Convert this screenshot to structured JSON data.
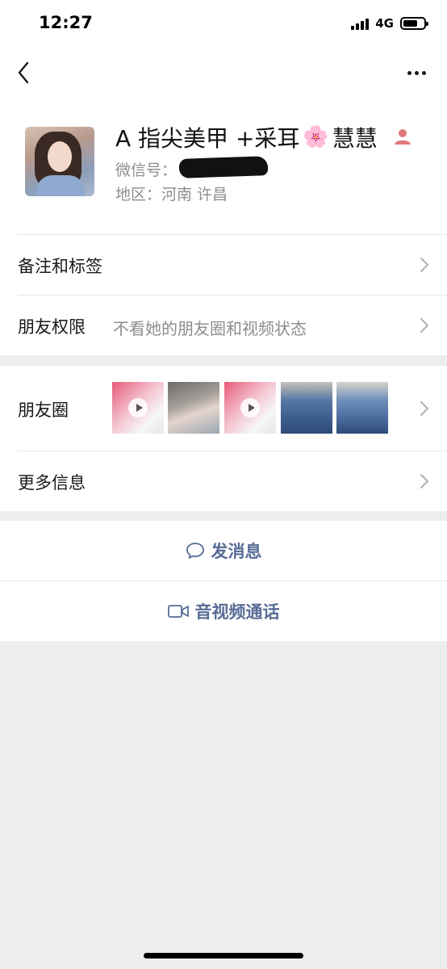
{
  "status_bar": {
    "time": "12:27",
    "network": "4G"
  },
  "nav": {
    "back_icon": "chevron-left-icon",
    "more_icon": "more-dots-icon"
  },
  "profile": {
    "name_prefix": "A 指尖美甲 +采耳",
    "name_flower": "🌸",
    "name_suffix": " 慧慧",
    "wechat_id_label": "微信号：",
    "region": "地区：河南 许昌",
    "contact_icon": "contact-person-icon",
    "contact_icon_color": "#e17a7a"
  },
  "rows": {
    "remarks_label": "备注和标签",
    "permissions_label": "朋友权限",
    "permissions_value": "不看她的朋友圈和视频状态",
    "moments_label": "朋友圈",
    "more_info_label": "更多信息"
  },
  "actions": {
    "message_label": "发消息",
    "message_icon": "chat-bubble-icon",
    "call_label": "音视频通话",
    "call_icon": "video-camera-icon",
    "accent_color": "#576b95"
  }
}
